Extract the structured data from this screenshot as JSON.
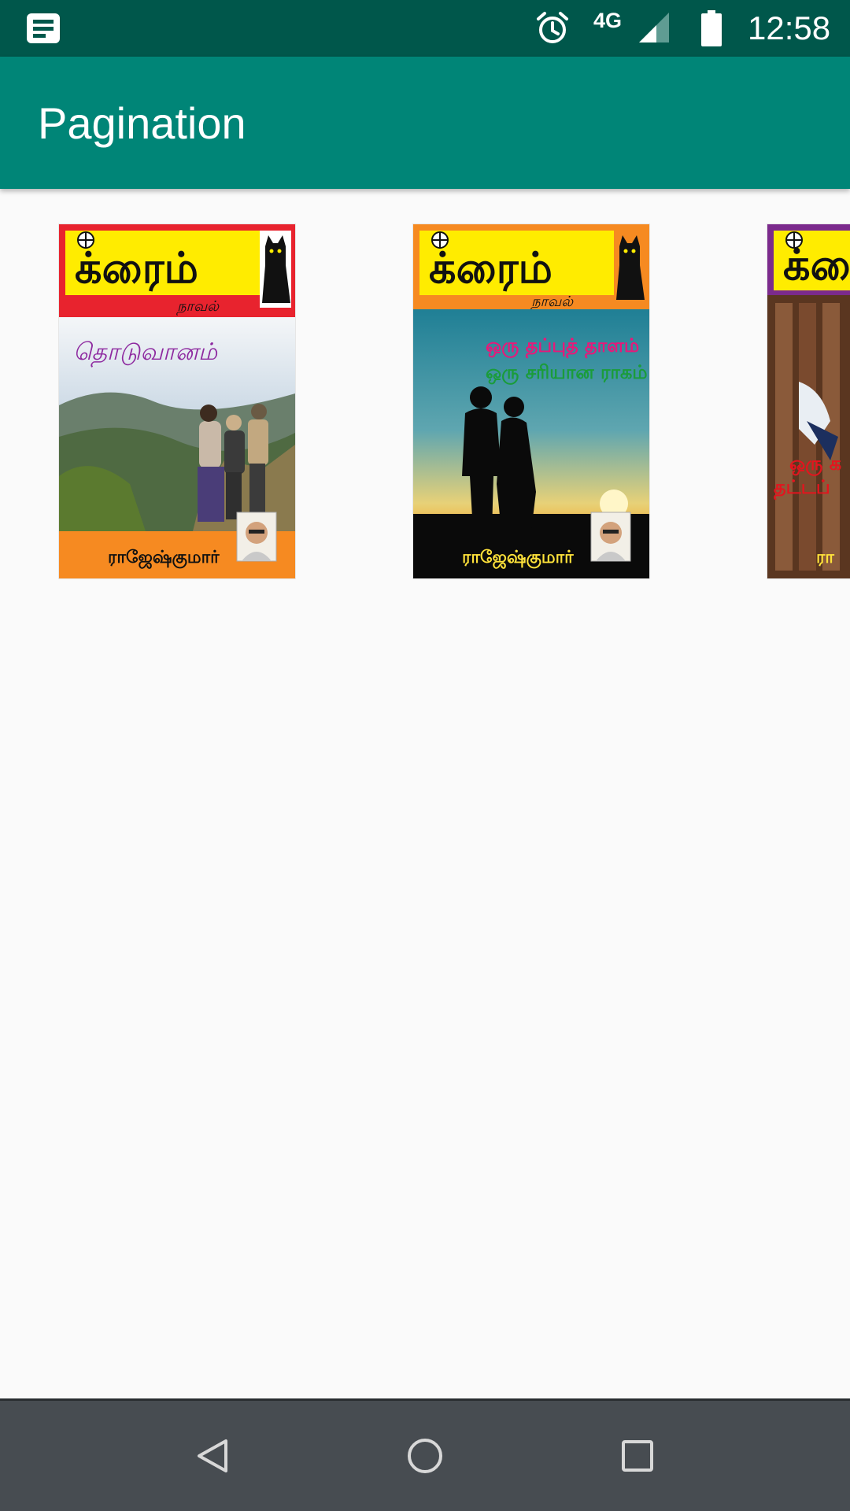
{
  "status_bar": {
    "notification_icon": "news-notification-icon",
    "alarm_icon": "alarm-clock-icon",
    "network_label": "4G",
    "signal_icon": "cell-signal-icon",
    "battery_icon": "battery-icon",
    "time": "12:58"
  },
  "app_bar": {
    "title": "Pagination",
    "color": "#008577",
    "status_color": "#00574b"
  },
  "books": [
    {
      "header_text": "க்ரைம்",
      "subheader_text": "நாவல்",
      "title": "தொடுவானம்",
      "author": "ராஜேஷ்குமார்",
      "header_color": "#e8232e",
      "footer_color": "#f68a21"
    },
    {
      "header_text": "க்ரைம்",
      "subheader_text": "நாவல்",
      "title_line1": "ஒரு தப்புத் தாளம்",
      "title_line2": "ஒரு சரியான ராகம்",
      "author": "ராஜேஷ்குமார்",
      "header_color": "#f68a21",
      "footer_color": "#0a0a0a"
    },
    {
      "header_text": "க்ரை",
      "title_line1": "ஒரு க",
      "title_line2": "தட்டப்",
      "author": "ரா",
      "header_color": "#7b2a8c",
      "footer_color": "#5a3620"
    }
  ],
  "nav_bar": {
    "back_icon": "back-triangle-icon",
    "home_icon": "home-circle-icon",
    "recents_icon": "recents-square-icon"
  }
}
